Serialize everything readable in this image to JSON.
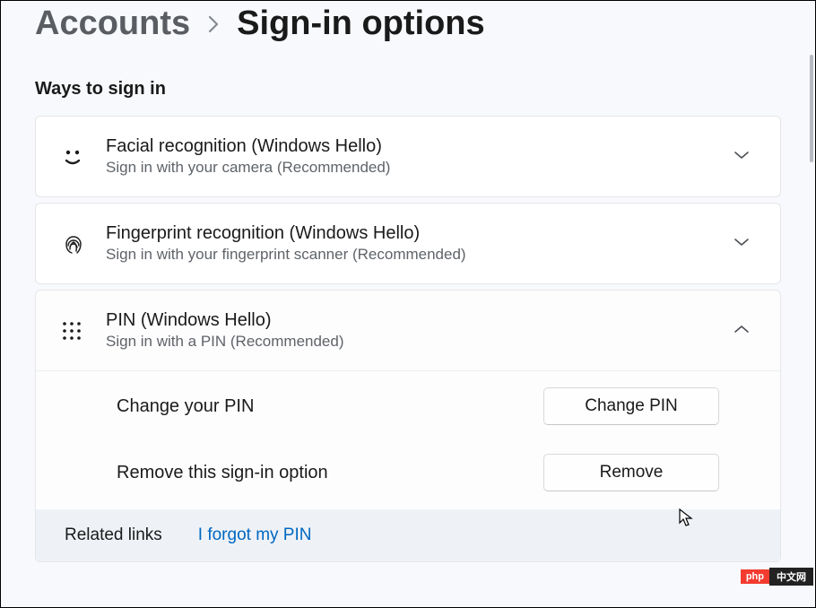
{
  "breadcrumb": {
    "parent": "Accounts",
    "current": "Sign-in options"
  },
  "section_heading": "Ways to sign in",
  "options": {
    "face": {
      "title": "Facial recognition (Windows Hello)",
      "sub": "Sign in with your camera (Recommended)"
    },
    "finger": {
      "title": "Fingerprint recognition (Windows Hello)",
      "sub": "Sign in with your fingerprint scanner (Recommended)"
    },
    "pin": {
      "title": "PIN (Windows Hello)",
      "sub": "Sign in with a PIN (Recommended)",
      "change_label": "Change your PIN",
      "change_button": "Change PIN",
      "remove_label": "Remove this sign-in option",
      "remove_button": "Remove"
    }
  },
  "related": {
    "heading": "Related links",
    "forgot": "I forgot my PIN"
  },
  "watermark": {
    "a": "php",
    "b": "中文网"
  }
}
